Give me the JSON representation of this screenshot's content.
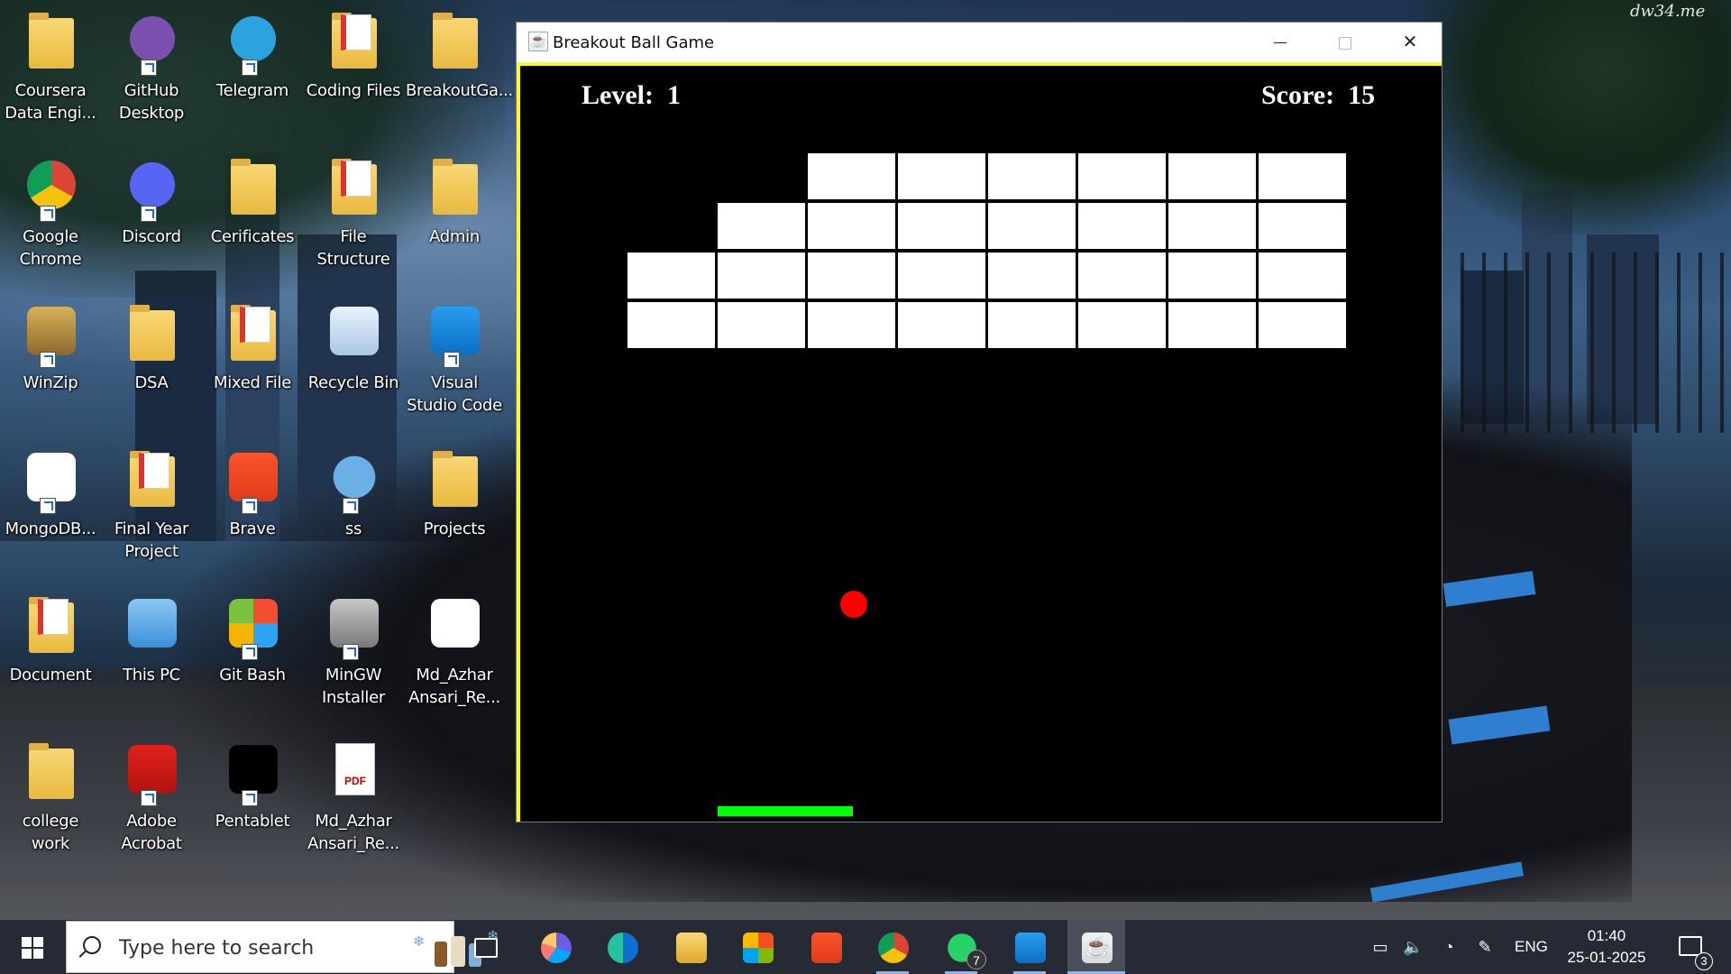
{
  "wallpaper": {
    "watermark": "dw34.me"
  },
  "desktop": {
    "icons": [
      {
        "label": "Coursera Data Engi...",
        "icon": "folder-icon"
      },
      {
        "label": "Google Chrome",
        "icon": "chrome-icon"
      },
      {
        "label": "WinZip",
        "icon": "winzip-icon"
      },
      {
        "label": "MongoDB...",
        "icon": "mongodb-icon"
      },
      {
        "label": "Document",
        "icon": "pdf-folder-icon"
      },
      {
        "label": "college work",
        "icon": "folder-icon"
      },
      {
        "label": "GitHub Desktop",
        "icon": "github-icon"
      },
      {
        "label": "Discord",
        "icon": "discord-icon"
      },
      {
        "label": "DSA",
        "icon": "folder-icon"
      },
      {
        "label": "Final Year Project",
        "icon": "pdf-folder-icon"
      },
      {
        "label": "This PC",
        "icon": "computer-icon"
      },
      {
        "label": "Adobe Acrobat",
        "icon": "acrobat-icon"
      },
      {
        "label": "Telegram",
        "icon": "telegram-icon"
      },
      {
        "label": "Cerificates",
        "icon": "folder-icon"
      },
      {
        "label": "Mixed File",
        "icon": "pdf-folder-icon"
      },
      {
        "label": "Brave",
        "icon": "brave-icon"
      },
      {
        "label": "Git Bash",
        "icon": "git-icon"
      },
      {
        "label": "Pentablet",
        "icon": "xppen-icon"
      },
      {
        "label": "Coding Files",
        "icon": "pdf-folder-icon"
      },
      {
        "label": "File Structure",
        "icon": "pdf-folder-icon"
      },
      {
        "label": "Recycle Bin",
        "icon": "recycle-bin-icon"
      },
      {
        "label": "ss",
        "icon": "bird-app-icon"
      },
      {
        "label": "MinGW Installer",
        "icon": "installer-icon"
      },
      {
        "label": "Md_Azhar Ansari_Re...",
        "icon": "pdf-file-icon"
      },
      {
        "label": "BreakoutGa...",
        "icon": "folder-icon"
      },
      {
        "label": "Admin",
        "icon": "user-folder-icon"
      },
      {
        "label": "Visual Studio Code",
        "icon": "vscode-icon"
      },
      {
        "label": "Projects",
        "icon": "folder-icon"
      },
      {
        "label": "Md_Azhar Ansari_Re...",
        "icon": "word-file-icon"
      }
    ]
  },
  "window": {
    "title": "Breakout Ball Game",
    "buttons": {
      "minimize": "minimize",
      "maximize": "maximize",
      "close": "close"
    },
    "colors": {
      "border_accent": "#ffff00",
      "background": "#000000",
      "brick": "#ffffff",
      "ball": "#ff0000",
      "paddle": "#00ff00"
    }
  },
  "game": {
    "level_label": "Level:",
    "level": "1",
    "score_label": "Score:",
    "score": "15",
    "brick_grid": {
      "rows": 4,
      "cols": 8,
      "present": [
        [
          0,
          0,
          1,
          1,
          1,
          1,
          1,
          1
        ],
        [
          0,
          1,
          1,
          1,
          1,
          1,
          1,
          1
        ],
        [
          1,
          1,
          1,
          1,
          1,
          1,
          1,
          1
        ],
        [
          1,
          1,
          1,
          1,
          1,
          1,
          1,
          1
        ]
      ]
    }
  },
  "taskbar": {
    "search_placeholder": "Type here to search",
    "apps": [
      {
        "name": "task-view",
        "icon": "task-view-icon"
      },
      {
        "name": "copilot",
        "icon": "copilot-icon"
      },
      {
        "name": "edge",
        "icon": "edge-icon"
      },
      {
        "name": "file-explorer",
        "icon": "folder-icon"
      },
      {
        "name": "microsoft-store",
        "icon": "store-icon"
      },
      {
        "name": "brave",
        "icon": "brave-icon"
      },
      {
        "name": "chrome",
        "icon": "chrome-icon"
      },
      {
        "name": "whatsapp",
        "icon": "whatsapp-icon",
        "badge": "7"
      },
      {
        "name": "vscode",
        "icon": "vscode-icon"
      },
      {
        "name": "java",
        "icon": "java-icon"
      }
    ],
    "tray": {
      "language": "ENG",
      "time": "01:40",
      "date": "25-01-2025",
      "notifications": "3"
    }
  }
}
